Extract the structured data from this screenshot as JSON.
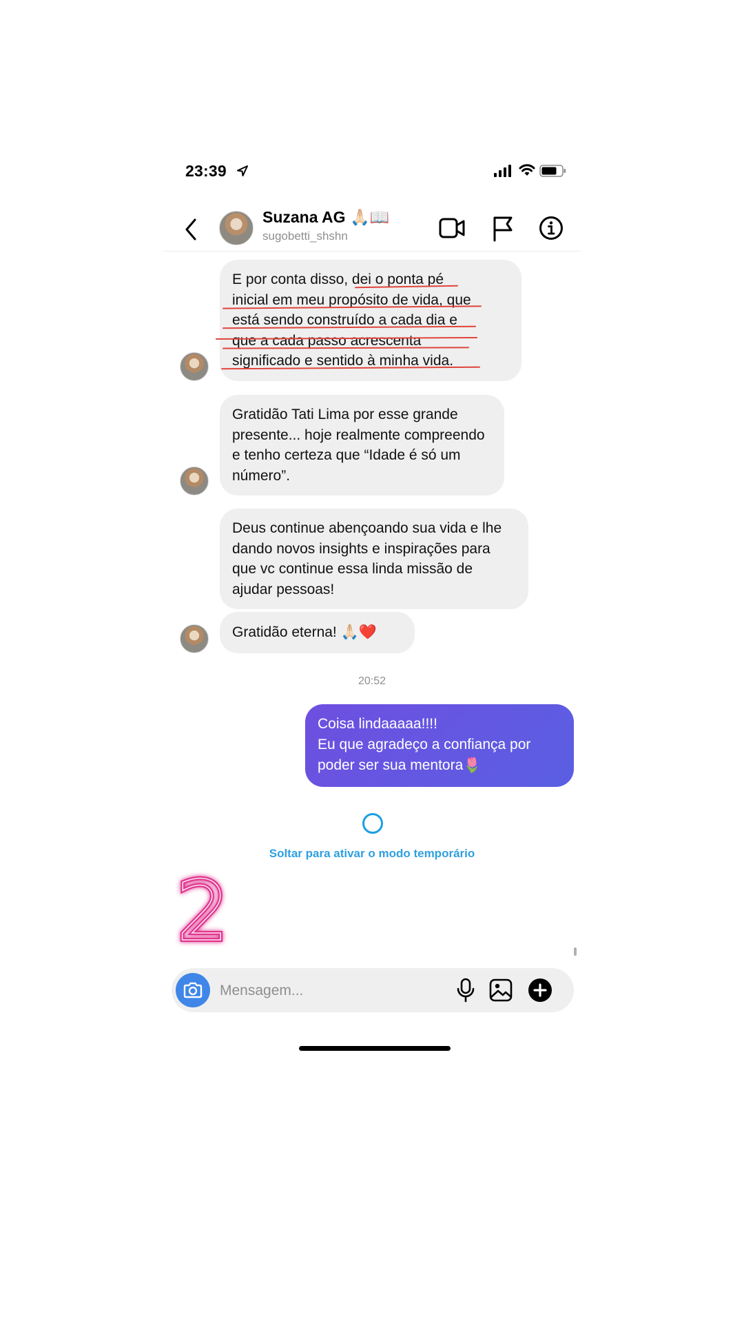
{
  "status_bar": {
    "time": "23:39",
    "icons": [
      "location-arrow-icon",
      "signal-bars-icon",
      "wifi-icon",
      "battery-icon"
    ]
  },
  "header": {
    "contact_name": "Suzana AG 🙏🏻📖",
    "contact_handle": "sugobetti_shshn",
    "icons": [
      "back-chevron-icon",
      "video-call-icon",
      "flag-icon",
      "info-icon"
    ]
  },
  "messages": {
    "m1_lines": [
      "E por conta disso, dei o ponta pé",
      "inicial em meu propósito de vida, que",
      "está sendo construído a cada dia e",
      "que a cada passo acrescenta",
      "significado e sentido à minha vida."
    ],
    "m2": "Gratidão Tati Lima por esse grande presente... hoje realmente compreendo e tenho certeza que “Idade é só um número”.",
    "m3": "Deus continue abençoando sua vida e lhe dando novos insights e inspirações para que vc continue essa linda missão de ajudar pessoas!",
    "m4": "Gratidão eterna! 🙏🏻❤️",
    "timestamp": "20:52",
    "out_lines": [
      "Coisa lindaaaaa!!!!",
      "Eu que agradeço a confiança por",
      "poder ser sua mentora🌷"
    ]
  },
  "temp_mode_label": "Soltar para ativar o modo temporário",
  "overlay_number": "2",
  "composer": {
    "placeholder": "Mensagem...",
    "icons": [
      "camera-icon",
      "microphone-icon",
      "gallery-icon",
      "plus-icon"
    ]
  },
  "colors": {
    "outgoing_bubble": "#5a5fe2",
    "incoming_bubble": "#efefef",
    "accent_blue": "#2f9fe0",
    "underline_red": "#e0443b",
    "neon_pink": "#e0358f"
  }
}
